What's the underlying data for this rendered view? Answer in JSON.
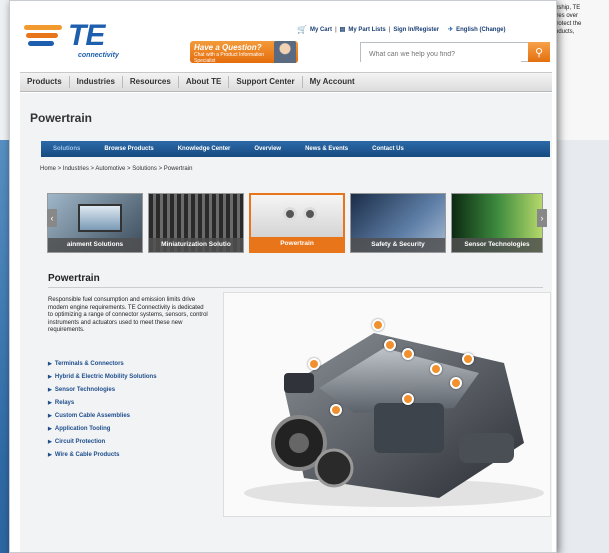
{
  "background_window": {
    "lines": [
      "ership, TE",
      "ures over",
      "protect the",
      "roducts,",
      "s."
    ]
  },
  "header": {
    "logo_text": "TE",
    "logo_sub": "connectivity",
    "question_title": "Have a Question?",
    "question_sub": "Chat with a Product Information Specialist",
    "top_links": {
      "cart": "My Cart",
      "parts": "My Part Lists",
      "signin": "Sign In/Register",
      "language": "English (Change)"
    },
    "search_placeholder": "What can we help you find?"
  },
  "main_nav": [
    "Products",
    "Industries",
    "Resources",
    "About TE",
    "Support Center",
    "My Account"
  ],
  "page_title": "Powertrain",
  "sub_nav": [
    "Solutions",
    "Browse Products",
    "Knowledge Center",
    "Overview",
    "News & Events",
    "Contact Us"
  ],
  "breadcrumb": "Home > Industries > Automotive > Solutions > Powertrain",
  "carousel": [
    "ainment Solutions",
    "Miniaturization Solutio",
    "Powertrain",
    "Safety & Security",
    "Sensor Technologies"
  ],
  "section": {
    "title": "Powertrain",
    "intro": "Responsible fuel consumption and emission limits drive modern engine requirements. TE Connectivity is dedicated to optimizing a range of connector systems, sensors, control instruments and actuators used to meet these new requirements.",
    "links": [
      "Terminals & Connectors",
      "Hybrid & Electric Mobility Solutions",
      "Sensor Technologies",
      "Relays",
      "Custom Cable Assemblies",
      "Application Tooling",
      "Circuit Protection",
      "Wire & Cable Products"
    ]
  },
  "colors": {
    "accent_orange": "#e8751a",
    "brand_blue": "#1d5fae",
    "subnav_blue": "#174a80"
  }
}
